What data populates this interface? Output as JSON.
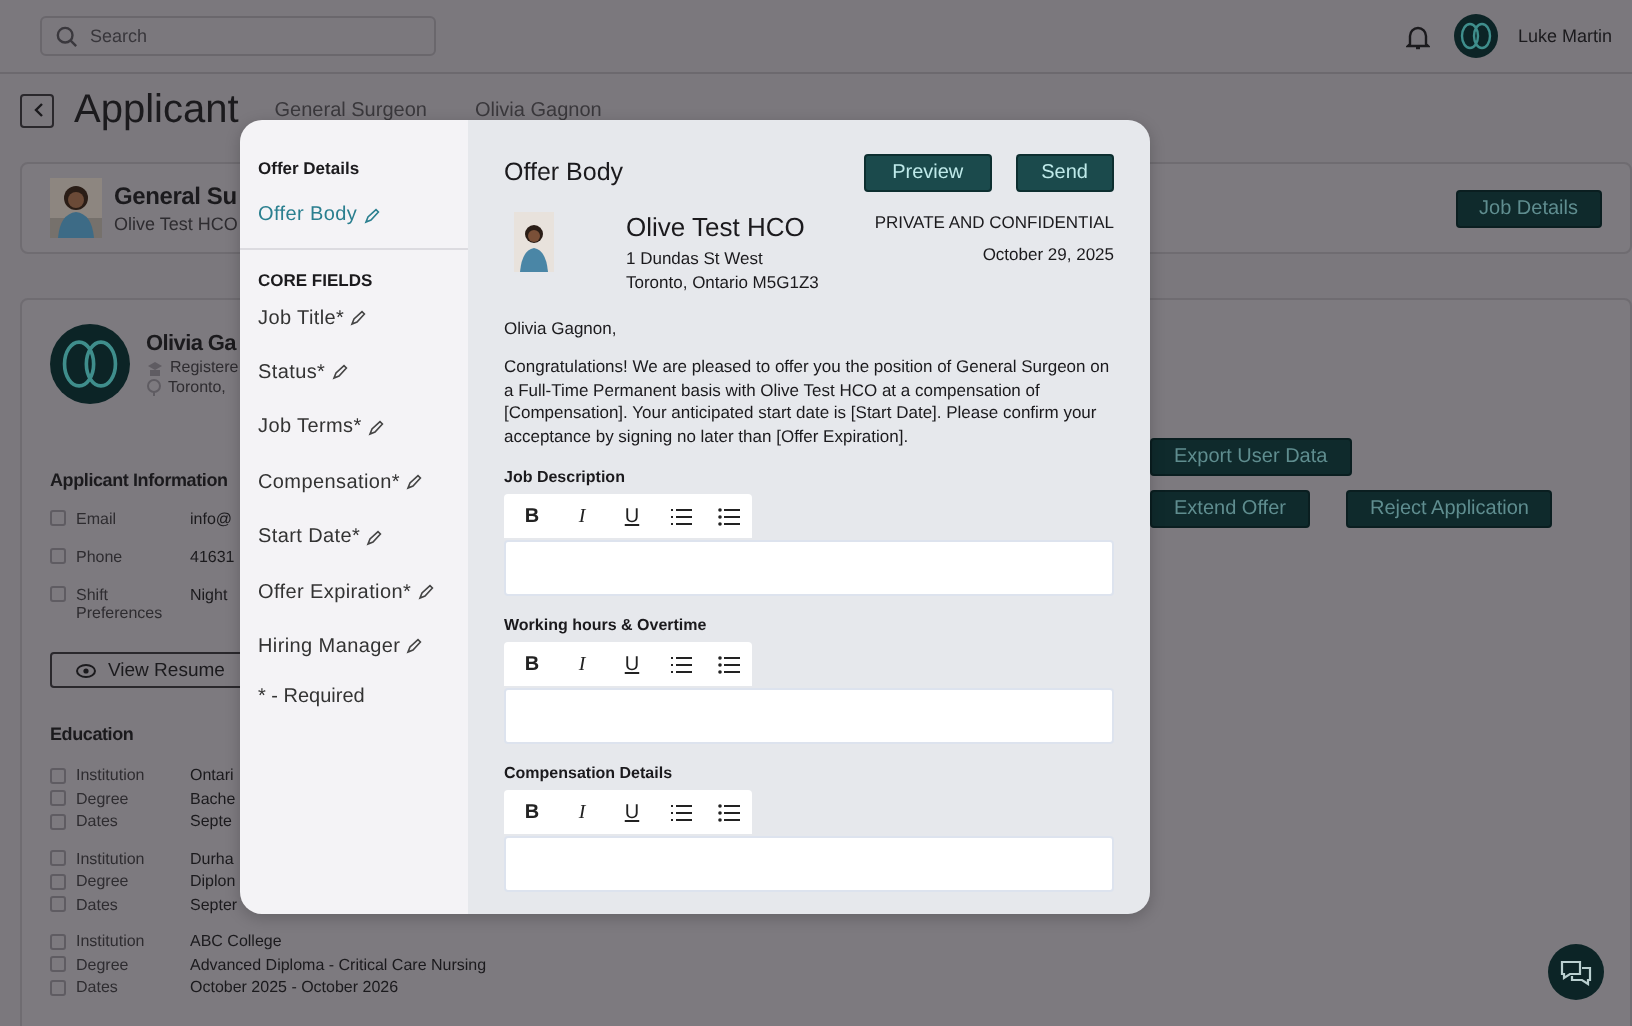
{
  "top_bar": {
    "search": {
      "placeholder": "Search"
    },
    "user_name": "Luke Martin"
  },
  "header": {
    "title": "Applicant",
    "breadcrumbs": [
      "General Surgeon",
      "Olivia Gagnon"
    ]
  },
  "job_card": {
    "title": "General Su",
    "organization": "Olive Test HCO",
    "button": "Job Details"
  },
  "applicant_card": {
    "name": "Olivia Ga",
    "role": "Registere",
    "location": "Toronto,",
    "info_heading": "Applicant Information",
    "info": [
      {
        "label": "Email",
        "value": "info@"
      },
      {
        "label": "Phone",
        "value": "41631"
      },
      {
        "label": "Shift Preferences",
        "value": "Night"
      }
    ],
    "resume_button": "View Resume",
    "education_heading": "Education",
    "education": [
      [
        {
          "label": "Institution",
          "value": "Ontari"
        },
        {
          "label": "Degree",
          "value": "Bache"
        },
        {
          "label": "Dates",
          "value": "Septe"
        }
      ],
      [
        {
          "label": "Institution",
          "value": "Durha"
        },
        {
          "label": "Degree",
          "value": "Diplon"
        },
        {
          "label": "Dates",
          "value": "Septer"
        }
      ],
      [
        {
          "label": "Institution",
          "value": "ABC College"
        },
        {
          "label": "Degree",
          "value": "Advanced Diploma - Critical Care Nursing"
        },
        {
          "label": "Dates",
          "value": "October 2025 - October 2026"
        }
      ]
    ],
    "actions": [
      [
        "Export User Data"
      ],
      [
        "Extend Offer",
        "Reject Application"
      ]
    ]
  },
  "modal": {
    "sidebar": {
      "sections": [
        {
          "heading": "Offer Details",
          "items": [
            {
              "label": "Offer Body",
              "selected": true
            }
          ]
        },
        {
          "heading": "CORE FIELDS",
          "items": [
            {
              "label": "Job Title*",
              "selected": false
            },
            {
              "label": "Status*",
              "selected": false
            },
            {
              "label": "Job Terms*",
              "selected": false
            },
            {
              "label": "Compensation*",
              "selected": false
            },
            {
              "label": "Start Date*",
              "selected": false
            },
            {
              "label": "Offer Expiration*",
              "selected": false
            },
            {
              "label": "Hiring Manager",
              "selected": false
            }
          ]
        }
      ],
      "note": "* - Required"
    },
    "title": "Offer Body",
    "buttons": [
      "Preview",
      "Send"
    ],
    "letter": {
      "company": "Olive Test HCO",
      "address": [
        "1 Dundas St West",
        "Toronto, Ontario M5G1Z3"
      ],
      "confidential": "PRIVATE AND CONFIDENTIAL",
      "date": "October 29, 2025",
      "greeting": "Olivia Gagnon,",
      "body": "Congratulations! We are pleased to offer you the position of General Surgeon on a Full-Time Permanent basis with Olive Test HCO at a compensation of [Compensation]. Your anticipated start date is [Start Date]. Please confirm your acceptance by signing no later than [Offer Expiration]."
    },
    "editors": [
      {
        "label": "Job Description",
        "toolbar": [
          "B",
          "I",
          "U"
        ]
      },
      {
        "label": "Working hours & Overtime",
        "toolbar": [
          "B",
          "I",
          "U"
        ]
      },
      {
        "label": "Compensation Details",
        "toolbar": [
          "B",
          "I",
          "U"
        ]
      }
    ]
  }
}
